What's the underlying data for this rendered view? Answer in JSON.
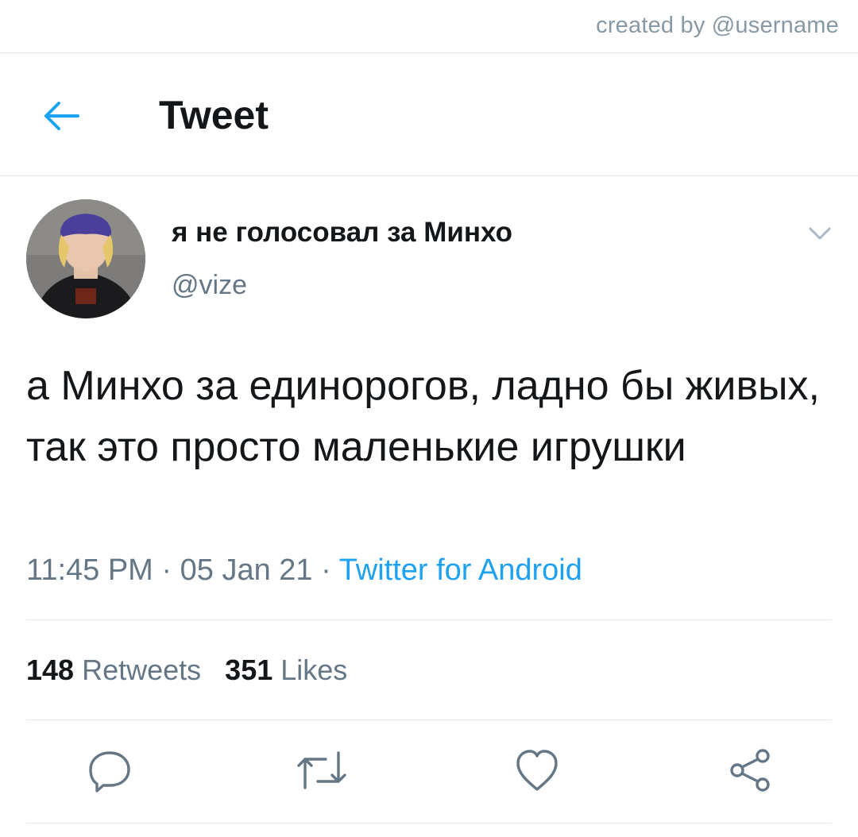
{
  "credit": "created by @username",
  "header": {
    "title": "Tweet",
    "back_icon": "arrow-left-icon"
  },
  "tweet": {
    "display_name": "я не голосовал за Минхо",
    "handle": "@vize",
    "text": "а Минхо за единорогов, ладно бы живых, так это просто маленькие игрушки",
    "time": "11:45 PM",
    "date": "05 Jan 21",
    "source": "Twitter for Android",
    "meta_separator": " · "
  },
  "stats": {
    "retweets_count": "148",
    "retweets_label": "Retweets",
    "likes_count": "351",
    "likes_label": "Likes"
  },
  "actions": [
    "reply-icon",
    "retweet-icon",
    "like-icon",
    "share-icon"
  ],
  "colors": {
    "accent": "#1da1f2",
    "text": "#14171a",
    "secondary": "#657786",
    "divider": "#e1e8ed",
    "icon": "#657786"
  }
}
